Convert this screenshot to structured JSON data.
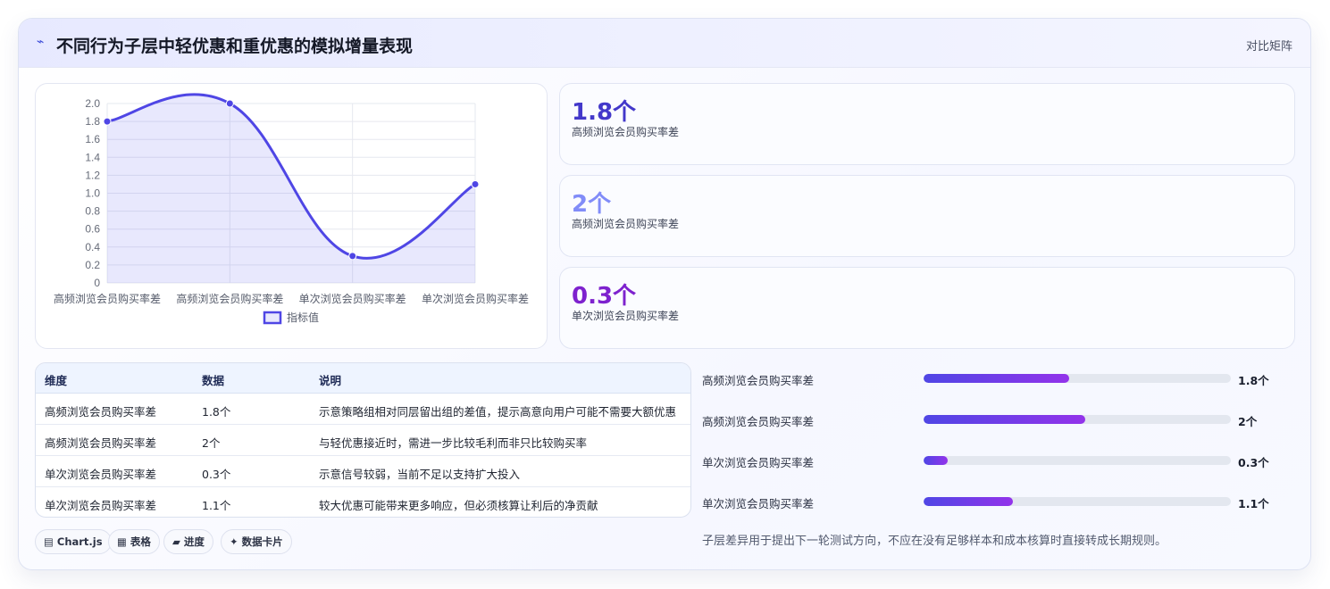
{
  "header": {
    "icon": "line-chart-icon",
    "title": "不同行为子层中轻优惠和重优惠的模拟增量表现",
    "mode_label": "对比矩阵"
  },
  "colors": {
    "line": "#4f46e5",
    "fill": "rgba(99,102,241,0.15)",
    "stat1": "#4338ca",
    "stat2": "#818cf8",
    "stat3": "#7e22ce",
    "accent_start": "#4f46e5",
    "accent_end": "#9333ea"
  },
  "chart_data": {
    "type": "line",
    "categories": [
      "高频浏览会员购买率差",
      "高频浏览会员购买率差",
      "单次浏览会员购买率差",
      "单次浏览会员购买率差"
    ],
    "series": [
      {
        "name": "指标值",
        "values": [
          1.8,
          2.0,
          0.3,
          1.1
        ]
      }
    ],
    "ylim": [
      0,
      2.0
    ],
    "yticks": [
      2.0,
      1.8,
      1.6,
      1.4,
      1.2,
      1.0,
      0.8,
      0.6,
      0.4,
      0.2,
      0
    ],
    "ytick_labels": [
      "2.0",
      "1.8",
      "1.6",
      "1.4",
      "1.2",
      "1.0",
      "0.8",
      "0.6",
      "0.4",
      "0.2",
      "0"
    ],
    "xlabel": "",
    "ylabel": "",
    "grid": true,
    "filled": true,
    "smooth": true,
    "legend": "bottom"
  },
  "stats": [
    {
      "value": "1.8个",
      "label": "高频浏览会员购买率差"
    },
    {
      "value": "2个",
      "label": "高频浏览会员购买率差"
    },
    {
      "value": "0.3个",
      "label": "单次浏览会员购买率差"
    }
  ],
  "table": {
    "headers": [
      "维度",
      "数据",
      "说明"
    ],
    "rows": [
      [
        "高频浏览会员购买率差",
        "1.8个",
        "示意策略组相对同层留出组的差值，提示高意向用户可能不需要大额优惠"
      ],
      [
        "高频浏览会员购买率差",
        "2个",
        "与轻优惠接近时，需进一步比较毛利而非只比较购买率"
      ],
      [
        "单次浏览会员购买率差",
        "0.3个",
        "示意信号较弱，当前不足以支持扩大投入"
      ],
      [
        "单次浏览会员购买率差",
        "1.1个",
        "较大优惠可能带来更多响应，但必须核算让利后的净贡献"
      ]
    ]
  },
  "tags": [
    {
      "icon": "chart-glyph",
      "label": "Chart.js"
    },
    {
      "icon": "table-glyph",
      "label": "表格"
    },
    {
      "icon": "progress-glyph",
      "label": "进度"
    },
    {
      "icon": "sparkle-glyph",
      "label": "数据卡片"
    }
  ],
  "bars": [
    {
      "label": "高频浏览会员购买率差",
      "value": 1.8,
      "value_text": "1.8个"
    },
    {
      "label": "高频浏览会员购买率差",
      "value": 2.0,
      "value_text": "2个"
    },
    {
      "label": "单次浏览会员购买率差",
      "value": 0.3,
      "value_text": "0.3个"
    },
    {
      "label": "单次浏览会员购买率差",
      "value": 1.1,
      "value_text": "1.1个"
    }
  ],
  "bars_max": 3.8,
  "note": "子层差异用于提出下一轮测试方向，不应在没有足够样本和成本核算时直接转成长期规则。"
}
